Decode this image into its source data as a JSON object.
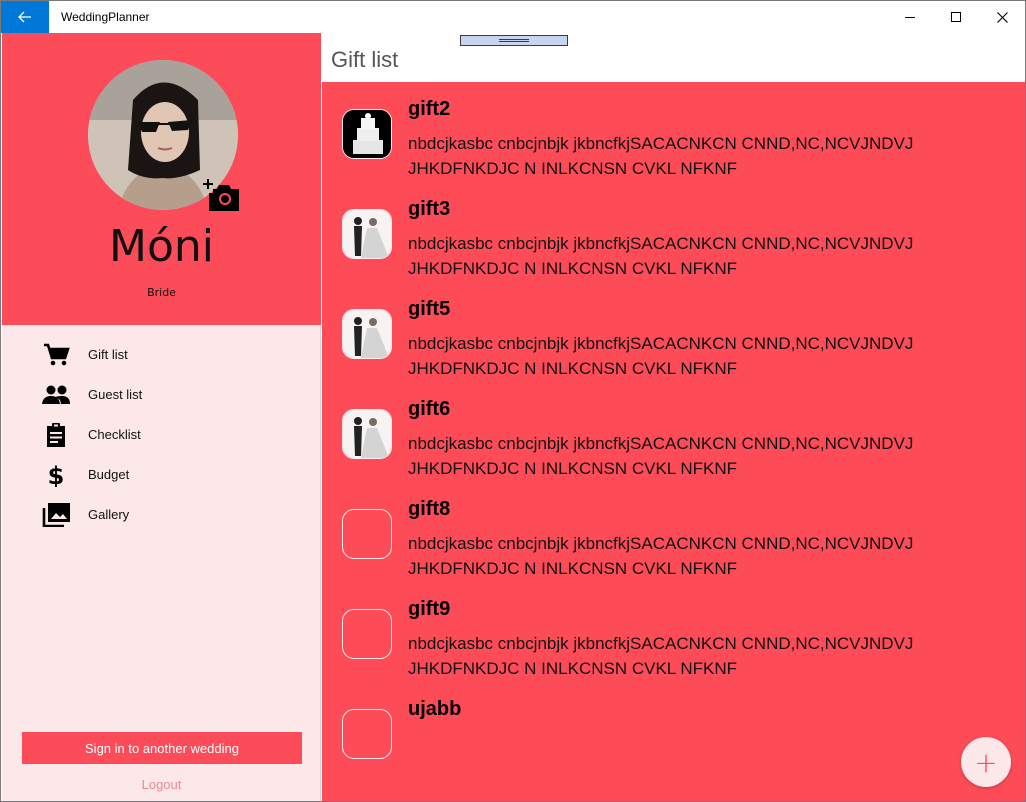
{
  "app": {
    "title": "WeddingPlanner",
    "accent": "#0078d7",
    "brand": "#fc4c5a"
  },
  "titlebar": {
    "back_icon": "arrow-left-icon",
    "minimize_icon": "minimize-icon",
    "maximize_icon": "maximize-icon",
    "close_icon": "close-icon"
  },
  "profile": {
    "name": "Móni",
    "role": "Bride",
    "camera_icon": "add-photo-icon"
  },
  "nav": {
    "items": [
      {
        "label": "Gift list",
        "icon": "cart-icon"
      },
      {
        "label": "Guest list",
        "icon": "people-icon"
      },
      {
        "label": "Checklist",
        "icon": "clipboard-icon"
      },
      {
        "label": "Budget",
        "icon": "dollar-icon"
      },
      {
        "label": "Gallery",
        "icon": "gallery-icon"
      }
    ]
  },
  "sidebar": {
    "signin_label": "Sign in to another wedding",
    "logout_label": "Logout"
  },
  "main": {
    "title": "Gift list",
    "add_icon": "plus-icon",
    "add_label": "+",
    "gifts": [
      {
        "name": "gift2",
        "description": "nbdcjkasbc cnbcjnbjk jkbncfkjSACACNKCN CNND,NC,NCVJNDVJ JHKDFNKDJC N INLKCNSN CVKL NFKNF",
        "thumb": "cake"
      },
      {
        "name": "gift3",
        "description": "nbdcjkasbc cnbcjnbjk jkbncfkjSACACNKCN CNND,NC,NCVJNDVJ JHKDFNKDJC N INLKCNSN CVKL NFKNF",
        "thumb": "couple"
      },
      {
        "name": "gift5",
        "description": "nbdcjkasbc cnbcjnbjk jkbncfkjSACACNKCN CNND,NC,NCVJNDVJ JHKDFNKDJC N INLKCNSN CVKL NFKNF",
        "thumb": "couple"
      },
      {
        "name": "gift6",
        "description": "nbdcjkasbc cnbcjnbjk jkbncfkjSACACNKCN CNND,NC,NCVJNDVJ JHKDFNKDJC N INLKCNSN CVKL NFKNF",
        "thumb": "couple"
      },
      {
        "name": "gift8",
        "description": "nbdcjkasbc cnbcjnbjk jkbncfkjSACACNKCN CNND,NC,NCVJNDVJ JHKDFNKDJC N INLKCNSN CVKL NFKNF",
        "thumb": "empty"
      },
      {
        "name": "gift9",
        "description": "nbdcjkasbc cnbcjnbjk jkbncfkjSACACNKCN CNND,NC,NCVJNDVJ JHKDFNKDJC N INLKCNSN CVKL NFKNF",
        "thumb": "empty"
      },
      {
        "name": "ujabb",
        "description": "",
        "thumb": "empty"
      }
    ]
  }
}
